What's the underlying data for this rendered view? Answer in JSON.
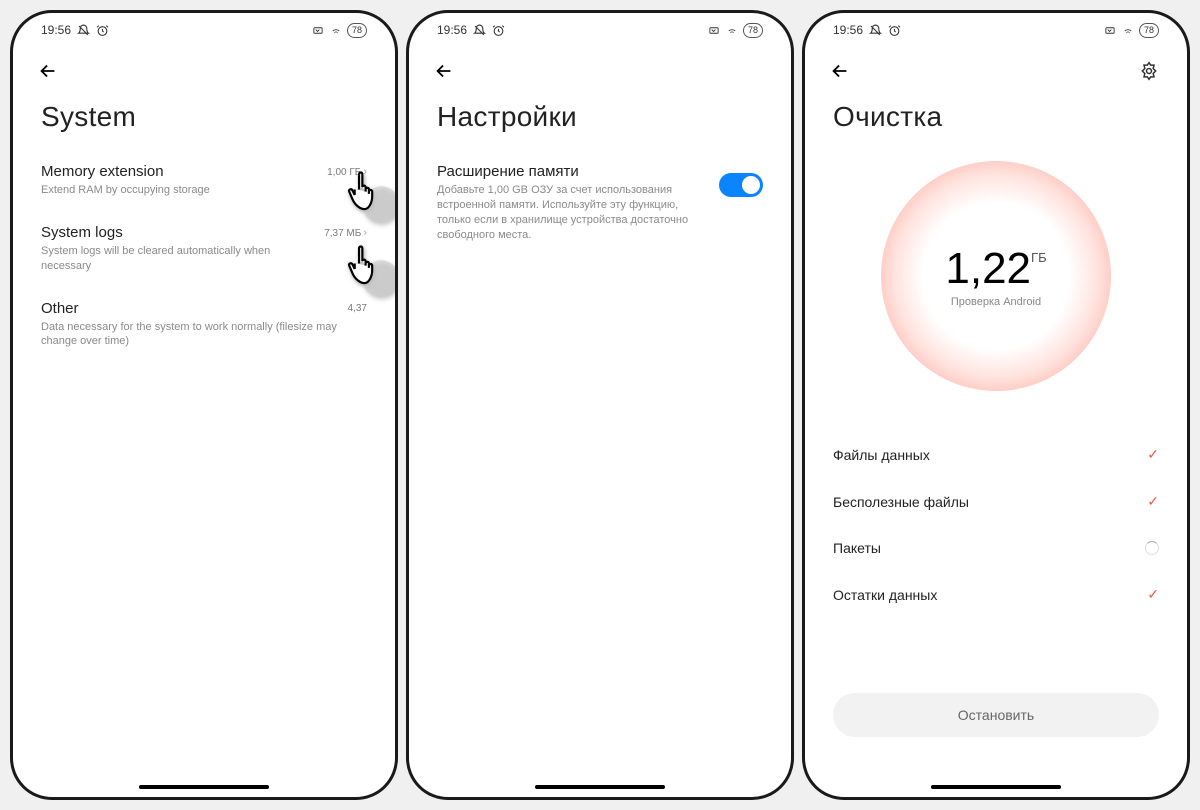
{
  "status": {
    "time": "19:56",
    "battery": "78"
  },
  "phone1": {
    "title": "System",
    "items": [
      {
        "title": "Memory extension",
        "desc": "Extend RAM by occupying storage",
        "value": "1,00 ГБ"
      },
      {
        "title": "System logs",
        "desc": "System logs will be cleared automatically when necessary",
        "value": "7,37 МБ"
      },
      {
        "title": "Other",
        "desc": "Data necessary for the system to work normally (filesize may change over time)",
        "value": "4,37"
      }
    ]
  },
  "phone2": {
    "title": "Настройки",
    "item": {
      "title": "Расширение памяти",
      "desc": "Добавьте 1,00 GB ОЗУ за счет использования встроенной памяти. Используйте эту функцию, только если в хранилище устройства достаточно свободного места."
    }
  },
  "phone3": {
    "title": "Очистка",
    "scan": {
      "value": "1,22",
      "unit": "ГБ",
      "sub": "Проверка Android"
    },
    "rows": [
      {
        "label": "Файлы данных",
        "state": "done"
      },
      {
        "label": "Бесполезные файлы",
        "state": "done"
      },
      {
        "label": "Пакеты",
        "state": "loading"
      },
      {
        "label": "Остатки данных",
        "state": "done"
      }
    ],
    "stop": "Остановить"
  }
}
